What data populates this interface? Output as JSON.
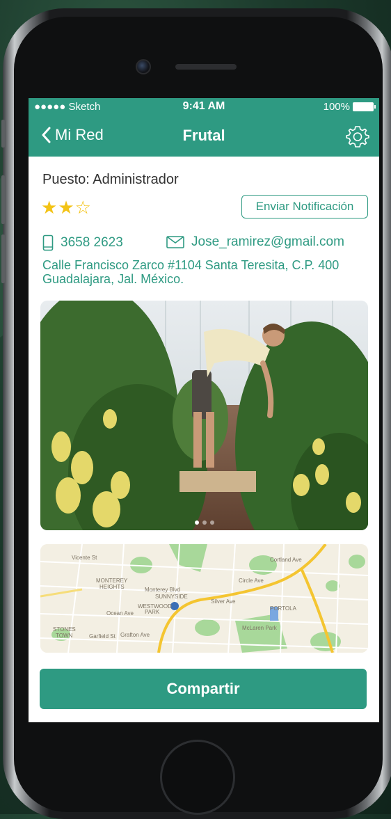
{
  "status_bar": {
    "carrier": "●●●●● Sketch",
    "time": "9:41 AM",
    "battery": "100%"
  },
  "nav": {
    "back_label": "Mi Red",
    "title": "Frutal"
  },
  "profile": {
    "role": "Puesto: Administrador",
    "rating": 2,
    "rating_max": 3,
    "notify_label": "Enviar Notificación",
    "phone": "3658 2623",
    "email": "Jose_ramirez@gmail.com",
    "address": "Calle Francisco Zarco #1104 Santa Teresita, C.P. 400 Guadalajara, Jal. México."
  },
  "gallery": {
    "pages": 3,
    "active": 0
  },
  "map": {
    "labels": [
      "Vicente St",
      "Monterey Blvd",
      "Ocean Ave",
      "Sunnyside",
      "Westwood Park",
      "Silver Ave",
      "Portola",
      "McLaren Park",
      "Garfield St",
      "Grafton Ave",
      "Stonestown",
      "Circle Ave",
      "Cortland Ave"
    ]
  },
  "share_label": "Compartir",
  "colors": {
    "accent": "#2e9a82",
    "star": "#f3c316"
  }
}
